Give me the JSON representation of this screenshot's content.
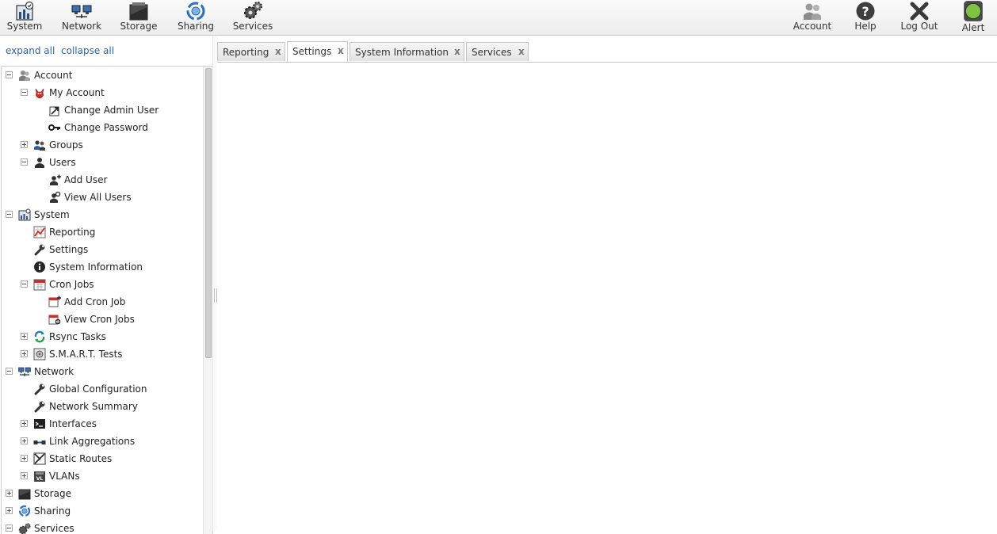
{
  "toolbar": {
    "left": [
      {
        "label": "System",
        "icon": "system-icon"
      },
      {
        "label": "Network",
        "icon": "network-icon"
      },
      {
        "label": "Storage",
        "icon": "storage-icon"
      },
      {
        "label": "Sharing",
        "icon": "sharing-icon"
      },
      {
        "label": "Services",
        "icon": "services-icon"
      }
    ],
    "right": [
      {
        "label": "Account",
        "icon": "account-icon"
      },
      {
        "label": "Help",
        "icon": "help-icon"
      },
      {
        "label": "Log Out",
        "icon": "logout-icon"
      },
      {
        "label": "Alert",
        "icon": "alert-icon",
        "status_color": "#7dc242"
      }
    ]
  },
  "sidebar": {
    "expand_all": "expand all",
    "collapse_all": "collapse all",
    "tree": [
      {
        "label": "Account",
        "icon": "account-icon",
        "level": 0,
        "expander": "collapse"
      },
      {
        "label": "My Account",
        "icon": "my-account-icon",
        "level": 1,
        "expander": "collapse"
      },
      {
        "label": "Change Admin User",
        "icon": "change-admin-icon",
        "level": 2,
        "expander": "none"
      },
      {
        "label": "Change Password",
        "icon": "key-icon",
        "level": 2,
        "expander": "none"
      },
      {
        "label": "Groups",
        "icon": "groups-icon",
        "level": 1,
        "expander": "expand"
      },
      {
        "label": "Users",
        "icon": "user-icon",
        "level": 1,
        "expander": "collapse"
      },
      {
        "label": "Add User",
        "icon": "add-user-icon",
        "level": 2,
        "expander": "none"
      },
      {
        "label": "View All Users",
        "icon": "view-users-icon",
        "level": 2,
        "expander": "none"
      },
      {
        "label": "System",
        "icon": "system-icon",
        "level": 0,
        "expander": "collapse"
      },
      {
        "label": "Reporting",
        "icon": "reporting-icon",
        "level": 1,
        "expander": "none"
      },
      {
        "label": "Settings",
        "icon": "wrench-icon",
        "level": 1,
        "expander": "none"
      },
      {
        "label": "System Information",
        "icon": "info-icon",
        "level": 1,
        "expander": "none"
      },
      {
        "label": "Cron Jobs",
        "icon": "calendar-icon",
        "level": 1,
        "expander": "collapse"
      },
      {
        "label": "Add Cron Job",
        "icon": "add-cron-icon",
        "level": 2,
        "expander": "none"
      },
      {
        "label": "View Cron Jobs",
        "icon": "view-cron-icon",
        "level": 2,
        "expander": "none"
      },
      {
        "label": "Rsync Tasks",
        "icon": "rsync-icon",
        "level": 1,
        "expander": "expand"
      },
      {
        "label": "S.M.A.R.T. Tests",
        "icon": "smart-icon",
        "level": 1,
        "expander": "expand"
      },
      {
        "label": "Network",
        "icon": "network-icon",
        "level": 0,
        "expander": "collapse"
      },
      {
        "label": "Global Configuration",
        "icon": "wrench-icon",
        "level": 1,
        "expander": "none"
      },
      {
        "label": "Network Summary",
        "icon": "wrench-icon",
        "level": 1,
        "expander": "none"
      },
      {
        "label": "Interfaces",
        "icon": "interfaces-icon",
        "level": 1,
        "expander": "expand"
      },
      {
        "label": "Link Aggregations",
        "icon": "lagg-icon",
        "level": 1,
        "expander": "expand"
      },
      {
        "label": "Static Routes",
        "icon": "routes-icon",
        "level": 1,
        "expander": "expand"
      },
      {
        "label": "VLANs",
        "icon": "vlan-icon",
        "level": 1,
        "expander": "expand"
      },
      {
        "label": "Storage",
        "icon": "storage-icon",
        "level": 0,
        "expander": "expand"
      },
      {
        "label": "Sharing",
        "icon": "sharing-icon",
        "level": 0,
        "expander": "expand"
      },
      {
        "label": "Services",
        "icon": "services-icon",
        "level": 0,
        "expander": "collapse"
      }
    ]
  },
  "tabs": [
    {
      "label": "Reporting",
      "active": false
    },
    {
      "label": "Settings",
      "active": true
    },
    {
      "label": "System Information",
      "active": false
    },
    {
      "label": "Services",
      "active": false
    }
  ],
  "tab_close_glyph": "x"
}
